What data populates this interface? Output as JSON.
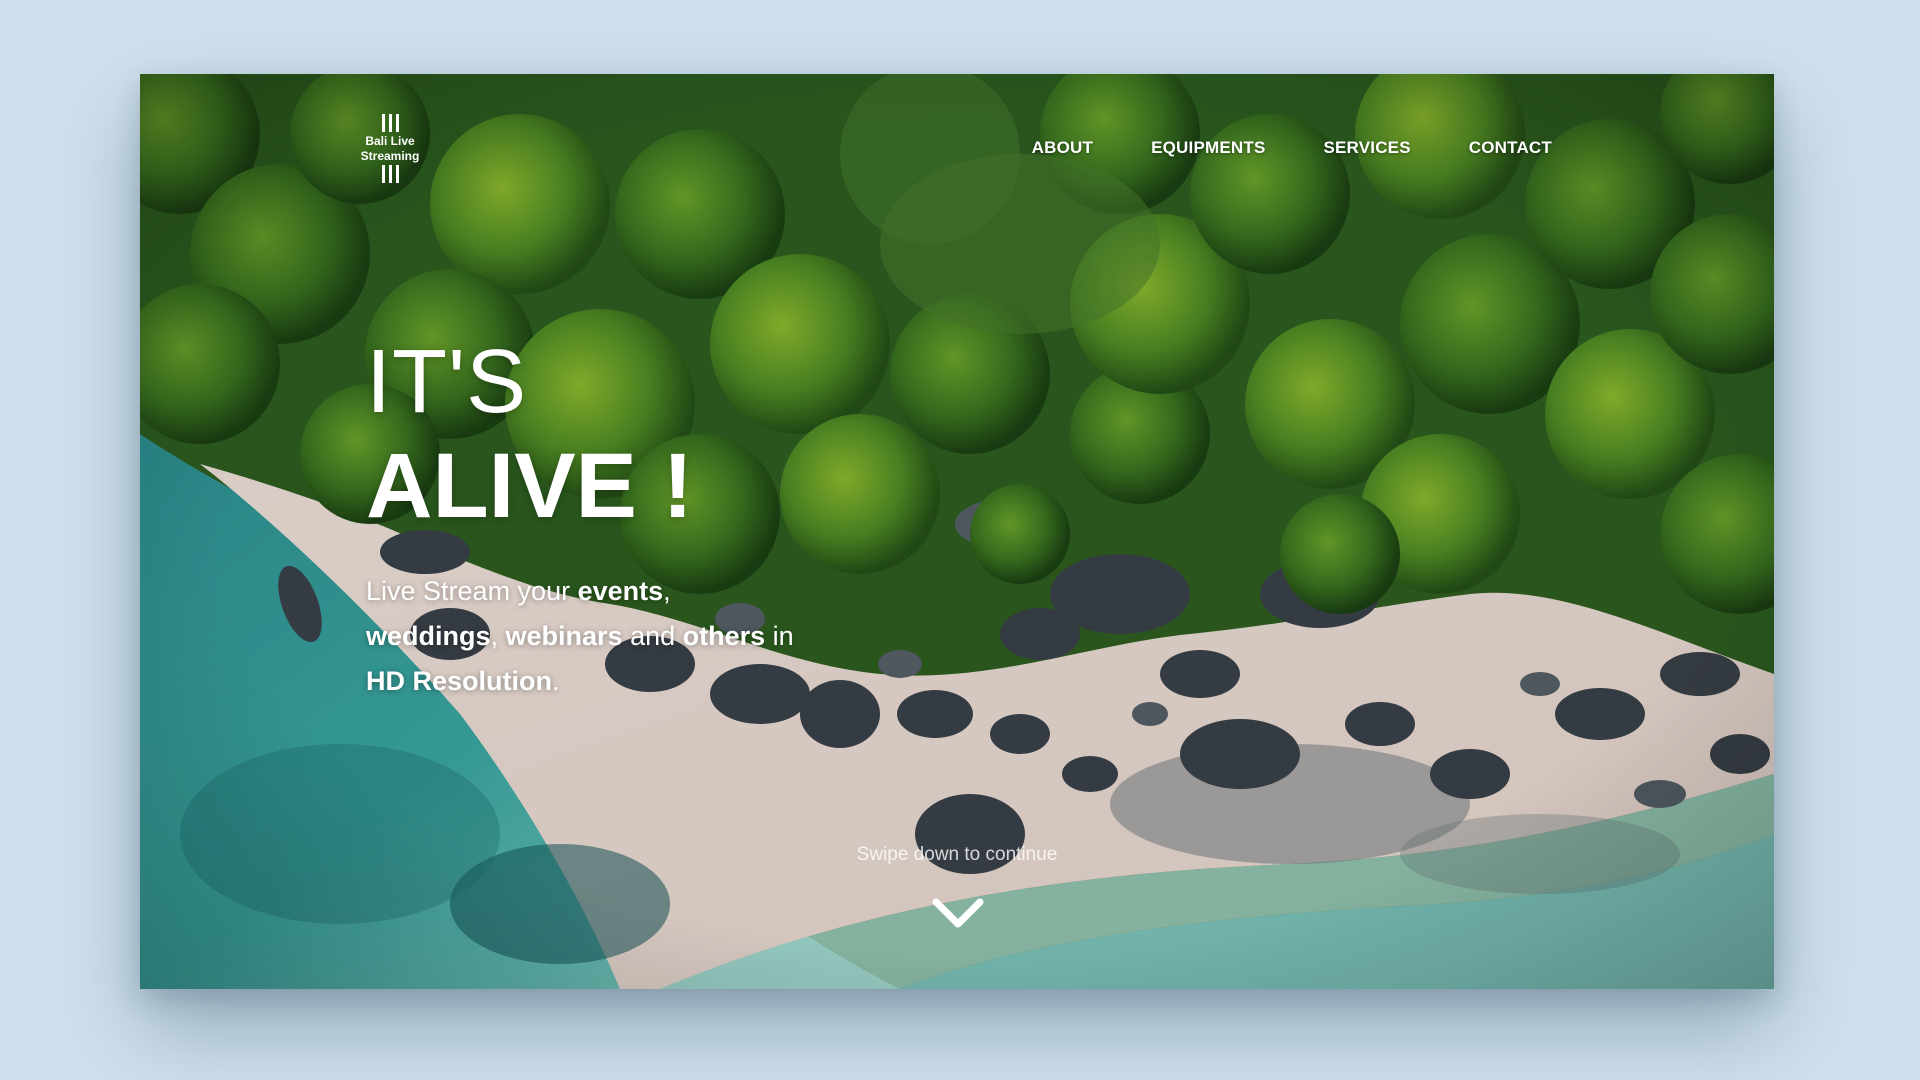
{
  "page": {
    "background_color": "#cfe1ec"
  },
  "brand": {
    "logo_line1": "Bali Live",
    "logo_line2": "Streaming"
  },
  "nav": {
    "items": [
      {
        "label": "ABOUT"
      },
      {
        "label": "EQUIPMENTS"
      },
      {
        "label": "SERVICES"
      },
      {
        "label": "CONTACT"
      }
    ]
  },
  "hero": {
    "headline_line1": "IT'S",
    "headline_line2": "ALIVE !",
    "tagline": {
      "t1": "Live Stream your ",
      "b1": "events",
      "t2": ",",
      "b2": "weddings",
      "t3": ", ",
      "b3": "webinars",
      "t4": " and ",
      "b4": "others",
      "t5": " in",
      "b5": "HD Resolution",
      "t6": "."
    },
    "swipe_text": "Swipe down to continue",
    "colors": {
      "forest": "#2f6a22",
      "sand": "#e9dcd4",
      "sea": "#3aa6a0",
      "rock": "#3a4148"
    }
  },
  "icons": {
    "scroll_down": "chevron-down-icon"
  }
}
